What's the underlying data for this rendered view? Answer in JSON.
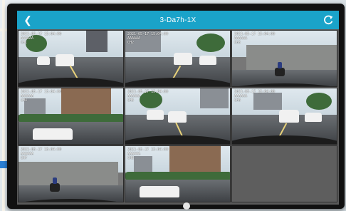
{
  "app": {
    "title": "3-Da7h-1X",
    "back_icon": "chevron-left-icon",
    "refresh_icon": "refresh-icon"
  },
  "channels": [
    {
      "id": "ch1",
      "timestamp": "2021-05-17 15:04:00",
      "tag": "AAAAAA",
      "label": "CH1",
      "scene": "street-front"
    },
    {
      "id": "ch2",
      "timestamp": "2021-05-17 15:04:00",
      "tag": "AAAAAA",
      "label": "CH2",
      "scene": "street-front"
    },
    {
      "id": "ch3",
      "timestamp": "2021-05-17 15:04:00",
      "tag": "AAAAAA",
      "label": "CH3",
      "scene": "wall-side"
    },
    {
      "id": "ch4",
      "timestamp": "2021-05-17 15:04:00",
      "tag": "AAAAAA",
      "label": "CH4",
      "scene": "building-side"
    },
    {
      "id": "ch5",
      "timestamp": "2021-05-17 15:04:00",
      "tag": "AAAAAA",
      "label": "CH5",
      "scene": "street-front"
    },
    {
      "id": "ch6",
      "timestamp": "2021-05-17 15:04:00",
      "tag": "AAAAAA",
      "label": "CH6",
      "scene": "street-front"
    },
    {
      "id": "ch7",
      "timestamp": "2021-05-17 15:04:00",
      "tag": "AAAAAA",
      "label": "CH7",
      "scene": "wall-side"
    },
    {
      "id": "ch8",
      "timestamp": "2021-05-17 15:04:00",
      "tag": "AAAAAA",
      "label": "CH8",
      "scene": "building-side"
    }
  ],
  "colors": {
    "header": "#1aa3c9",
    "grid_bg": "#5a5a5a",
    "bezel": "#111111"
  }
}
